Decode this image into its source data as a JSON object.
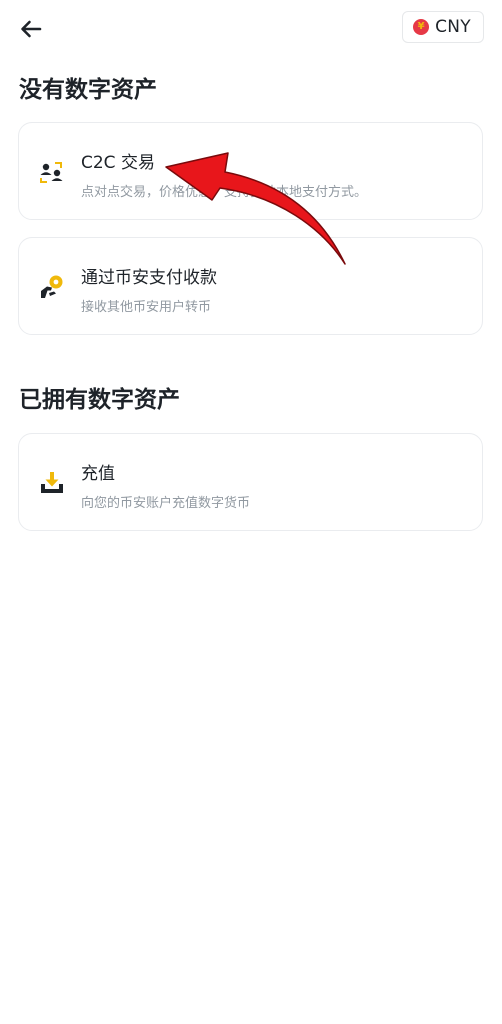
{
  "header": {
    "back_icon": "back-arrow-icon",
    "currency": {
      "symbol": "¥",
      "label": "CNY",
      "flag_color": "#e63946",
      "symbol_color": "#f0b90b"
    }
  },
  "sections": [
    {
      "title": "没有数字资产",
      "items": [
        {
          "title": "C2C 交易",
          "subtitle": "点对点交易，价格优惠，支持多种本地支付方式。",
          "icon": "people-exchange-icon"
        },
        {
          "title": "通过币安支付收款",
          "subtitle": "接收其他币安用户转币",
          "icon": "hand-coin-icon"
        }
      ]
    },
    {
      "title": "已拥有数字资产",
      "items": [
        {
          "title": "充值",
          "subtitle": "向您的币安账户充值数字货币",
          "icon": "deposit-tray-icon"
        }
      ]
    }
  ],
  "colors": {
    "accent": "#f0b90b",
    "text": "#1e2329",
    "subtext": "#9199a1",
    "annotation_arrow": "#e8161b"
  }
}
